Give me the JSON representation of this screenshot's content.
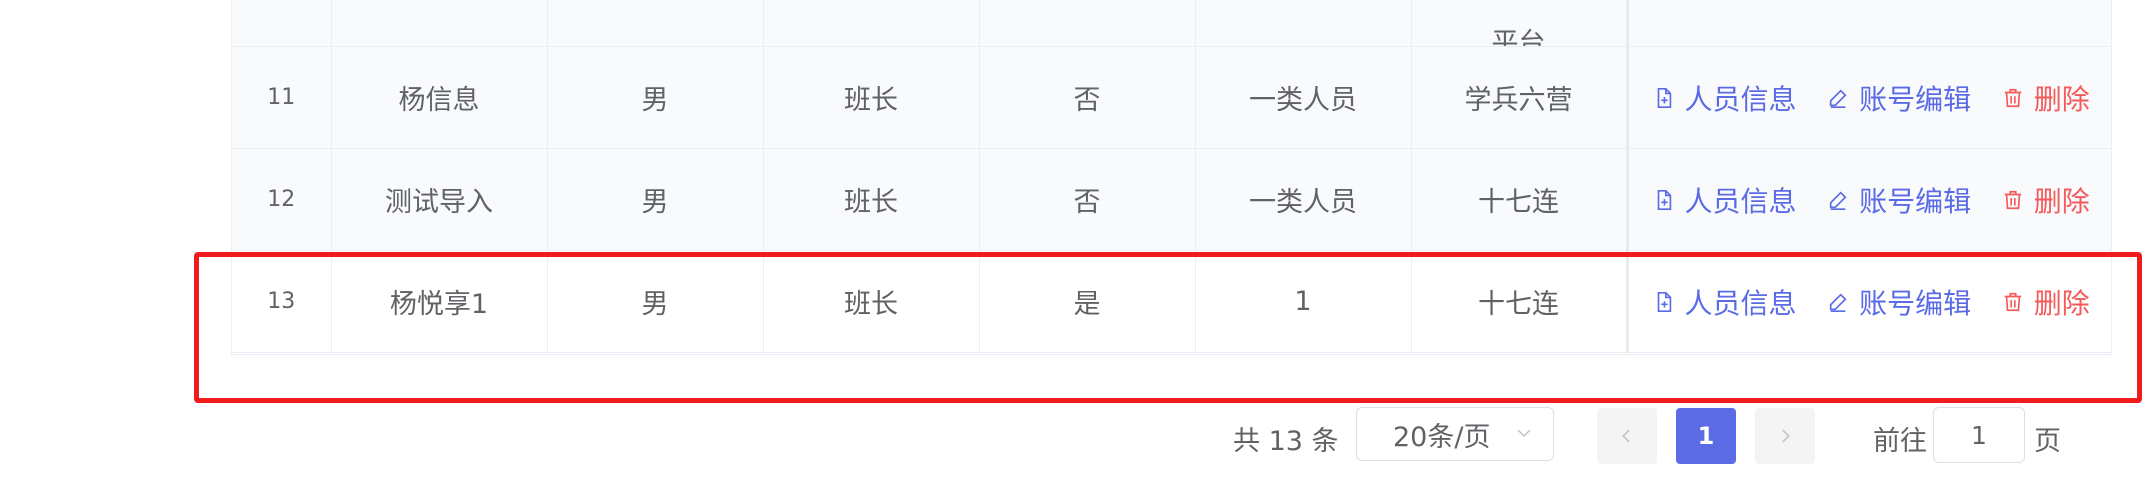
{
  "table": {
    "header_partial": "平台",
    "rows": [
      {
        "index": "11",
        "name": "杨信息",
        "gender": "男",
        "position": "班长",
        "flag": "否",
        "category": "一类人员",
        "unit": "学兵六营"
      },
      {
        "index": "12",
        "name": "测试导入",
        "gender": "男",
        "position": "班长",
        "flag": "否",
        "category": "一类人员",
        "unit": "十七连"
      },
      {
        "index": "13",
        "name": "杨悦享1",
        "gender": "男",
        "position": "班长",
        "flag": "是",
        "category": "1",
        "unit": "十七连"
      }
    ],
    "actions": {
      "info": "人员信息",
      "edit": "账号编辑",
      "delete": "删除"
    }
  },
  "pagination": {
    "total": "共 13 条",
    "page_size": "20条/页",
    "current_page": "1",
    "goto_label": "前往",
    "goto_value": "1",
    "page_unit": "页"
  },
  "colors": {
    "accent": "#5b6be6",
    "danger": "#f45a5a",
    "highlight": "#ee1c1c"
  }
}
